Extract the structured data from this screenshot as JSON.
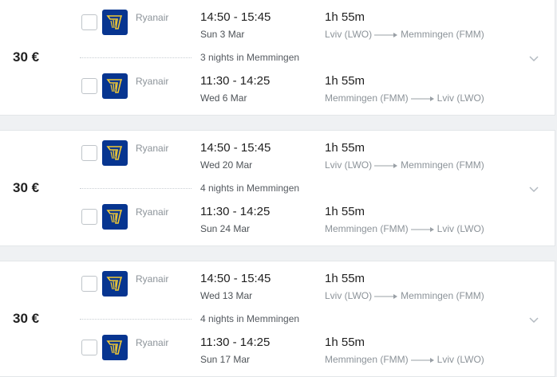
{
  "itineraries": [
    {
      "price": "30 €",
      "stay": "3 nights in Memmingen",
      "outbound": {
        "airline": "Ryanair",
        "times": "14:50 - 15:45",
        "date": "Sun 3 Mar",
        "duration": "1h 55m",
        "from": "Lviv (LWO)",
        "to": "Memmingen (FMM)"
      },
      "return": {
        "airline": "Ryanair",
        "times": "11:30 - 14:25",
        "date": "Wed 6 Mar",
        "duration": "1h 55m",
        "from": "Memmingen (FMM)",
        "to": "Lviv (LWO)"
      }
    },
    {
      "price": "30 €",
      "stay": "4 nights in Memmingen",
      "outbound": {
        "airline": "Ryanair",
        "times": "14:50 - 15:45",
        "date": "Wed 20 Mar",
        "duration": "1h 55m",
        "from": "Lviv (LWO)",
        "to": "Memmingen (FMM)"
      },
      "return": {
        "airline": "Ryanair",
        "times": "11:30 - 14:25",
        "date": "Sun 24 Mar",
        "duration": "1h 55m",
        "from": "Memmingen (FMM)",
        "to": "Lviv (LWO)"
      }
    },
    {
      "price": "30 €",
      "stay": "4 nights in Memmingen",
      "outbound": {
        "airline": "Ryanair",
        "times": "14:50 - 15:45",
        "date": "Wed 13 Mar",
        "duration": "1h 55m",
        "from": "Lviv (LWO)",
        "to": "Memmingen (FMM)"
      },
      "return": {
        "airline": "Ryanair",
        "times": "11:30 - 14:25",
        "date": "Sun 17 Mar",
        "duration": "1h 55m",
        "from": "Memmingen (FMM)",
        "to": "Lviv (LWO)"
      }
    }
  ],
  "colors": {
    "background": "#eff1f3",
    "card": "#ffffff",
    "ryanair_blue": "#073590",
    "ryanair_gold": "#f1c933",
    "muted_text": "#8c9399"
  },
  "icons": {
    "airline_logo": "ryanair-harp-icon",
    "expand": "chevron-down-icon",
    "route_arrow": "arrow-right-icon",
    "select": "checkbox"
  }
}
